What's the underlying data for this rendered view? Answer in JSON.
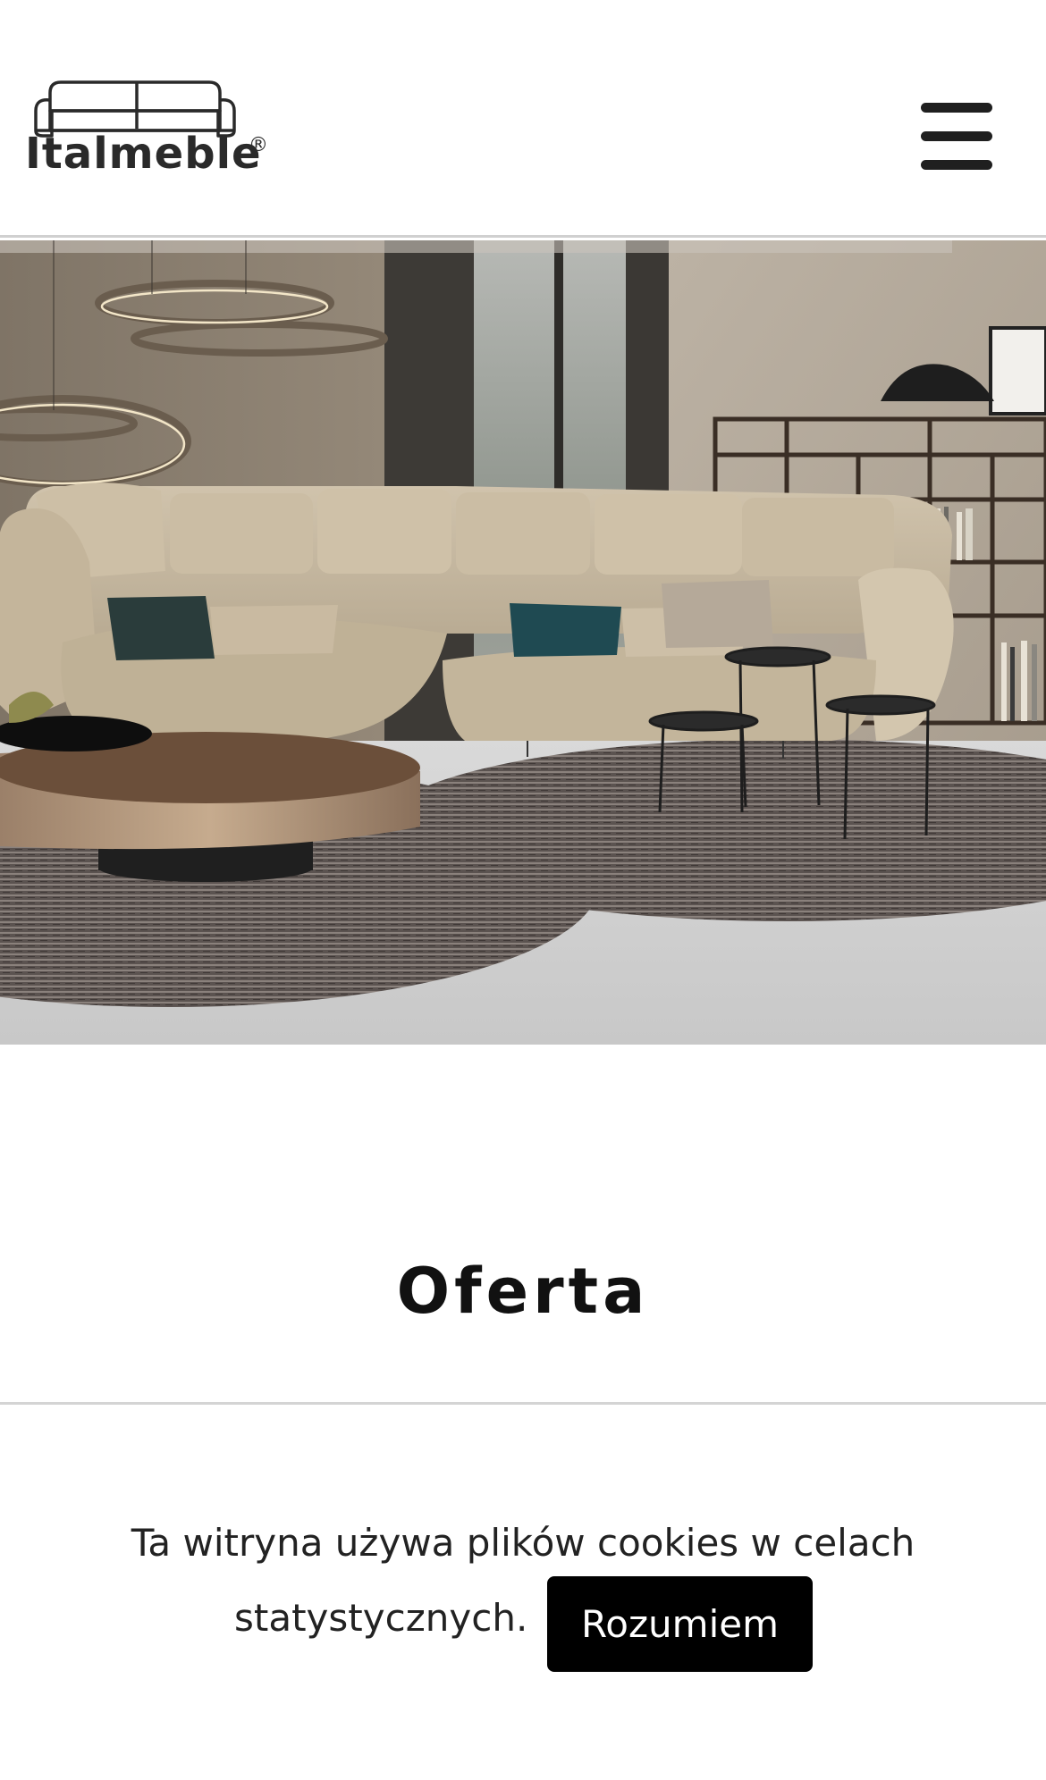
{
  "header": {
    "logo": {
      "text": "Italmeble",
      "registered": "®"
    },
    "menu_icon": "hamburger-menu-icon"
  },
  "hero": {
    "image": "living-room-photo",
    "alt": "Living room with beige sectional sofa, round coffee tables and ring pendant lamps"
  },
  "section": {
    "title": "Oferta"
  },
  "cookie_bar": {
    "text_line1": "Ta witryna używa plików cookies w celach",
    "text_line2": "statystycznych.",
    "accept_label": "Rozumiem"
  },
  "colors": {
    "background": "#ffffff",
    "text": "#222222",
    "button_bg": "#000000",
    "button_text": "#ffffff",
    "divider": "#d4d4d4"
  }
}
